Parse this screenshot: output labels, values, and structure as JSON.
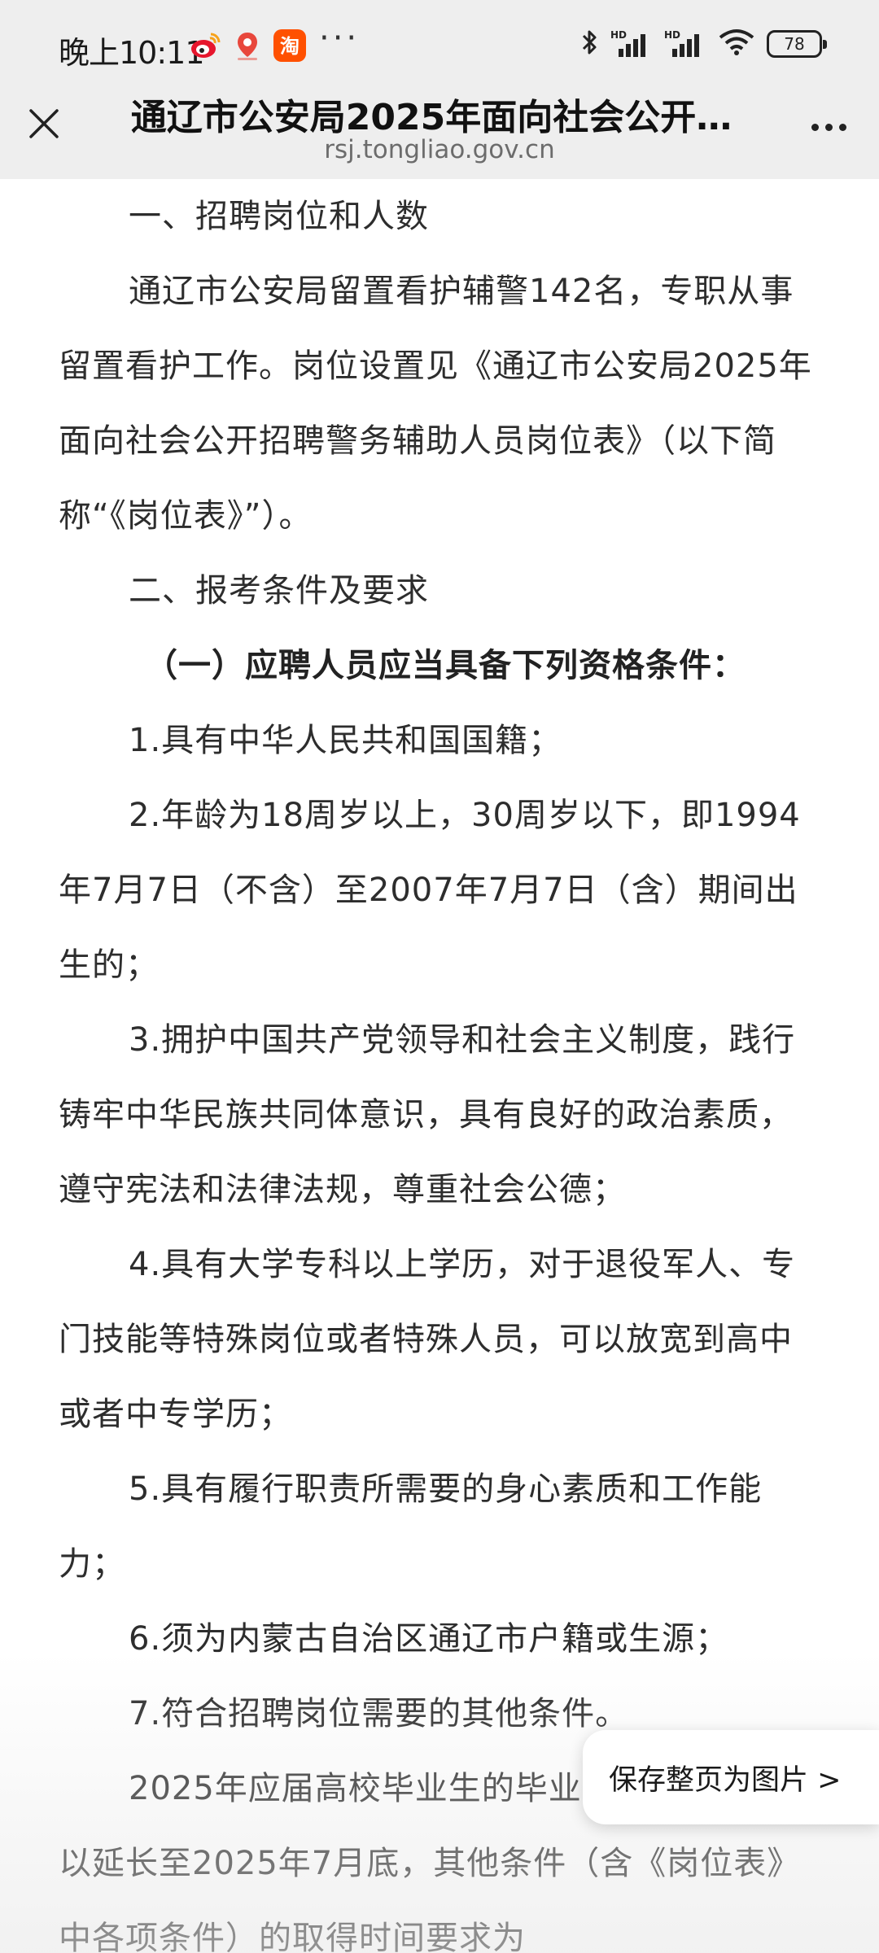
{
  "status_bar": {
    "time": "晚上10:11",
    "app_icons": [
      "weibo-icon",
      "map-pin-app-icon",
      "taobao-icon"
    ],
    "more": "···",
    "battery": "78"
  },
  "browser": {
    "title": "通辽市公安局2025年面向社会公开…",
    "url": "rsj.tongliao.gov.cn",
    "save_page_button": "保存整页为图片 >"
  },
  "article": {
    "paragraphs": [
      "一、招聘岗位和人数",
      "通辽市公安局留置看护辅警142名，专职从事留置看护工作。岗位设置见《通辽市公安局2025年面向社会公开招聘警务辅助人员岗位表》（以下简称“《岗位表》”）。",
      "二、报考条件及要求",
      "（一）应聘人员应当具备下列资格条件：",
      "1.具有中华人民共和国国籍；",
      "2.年龄为18周岁以上，30周岁以下，即1994年7月7日（不含）至2007年7月7日（含）期间出生的；",
      "3.拥护中国共产党领导和社会主义制度，践行铸牢中华民族共同体意识，具有良好的政治素质，遵守宪法和法律法规，尊重社会公德；",
      "4.具有大学专科以上学历，对于退役军人、专门技能等特殊岗位或者特殊人员，可以放宽到高中或者中专学历；",
      "5.具有履行职责所需要的身心素质和工作能力；",
      "6.须为内蒙古自治区通辽市户籍或生源；",
      "7.符合招聘岗位需要的其他条件。",
      "2025年应届高校毕业生的毕业证书取得时间可以延长至2025年7月底，其他条件（含《岗位表》中各项条件）的取得时间要求为"
    ]
  },
  "colors": {
    "chrome_bg": "#eeeeee",
    "text": "#2d2d2d",
    "url": "#6c6c6c"
  }
}
